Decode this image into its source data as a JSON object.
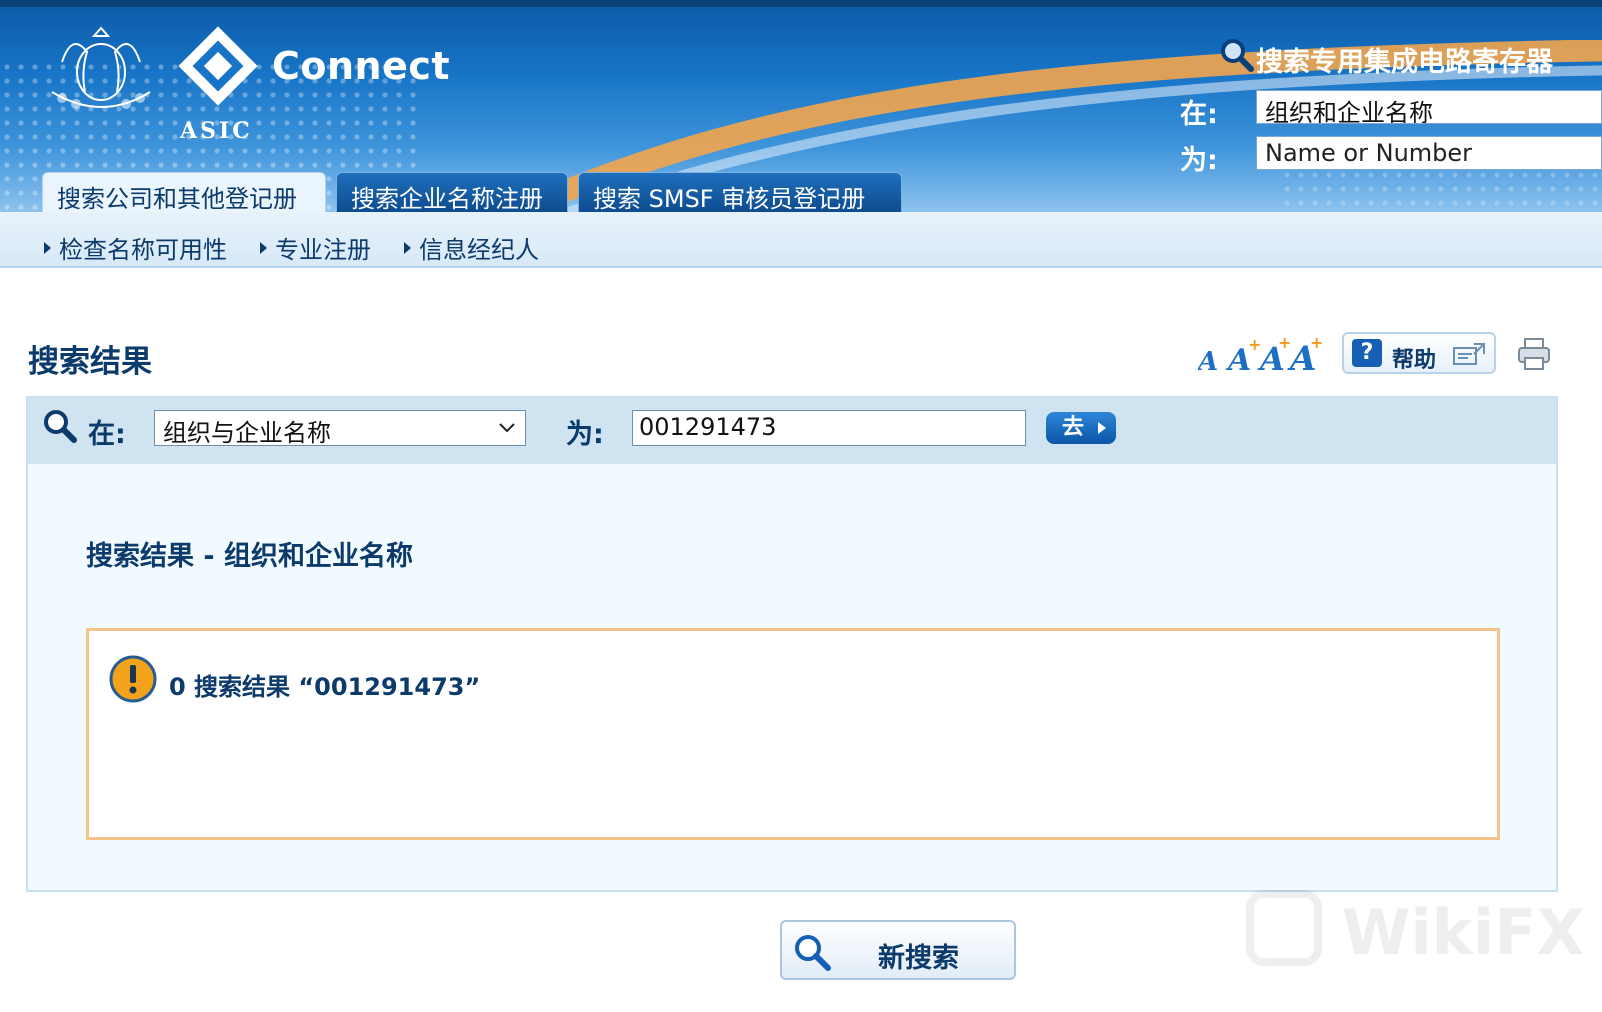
{
  "header": {
    "brand": "Connect",
    "agency": "ASIC",
    "quick_search": {
      "title": "搜索专用集成电路寄存器",
      "in_label": "在:",
      "in_value": "组织和企业名称",
      "for_label": "为:",
      "for_placeholder": "Name or Number"
    },
    "tabs": [
      {
        "label": "搜索公司和其他登记册",
        "active": true
      },
      {
        "label": "搜索企业名称注册",
        "active": false
      },
      {
        "label": "搜索 SMSF 审核员登记册",
        "active": false
      }
    ]
  },
  "subnav": [
    {
      "label": "检查名称可用性"
    },
    {
      "label": "专业注册"
    },
    {
      "label": "信息经纪人"
    }
  ],
  "page": {
    "title": "搜索结果",
    "help_label": "帮助"
  },
  "search_bar": {
    "in_label": "在:",
    "selected_register": "组织与企业名称",
    "for_label": "为:",
    "query": "001291473",
    "go_label": "去"
  },
  "results": {
    "heading": "搜索结果 - 组织和企业名称",
    "message": "0 搜索结果 “001291473”"
  },
  "new_search_label": "新搜索",
  "watermark": "WikiFX",
  "colors": {
    "header_blue": "#1774c6",
    "navy_text": "#0b3a6b",
    "result_border": "#f2c48a",
    "warning_orange": "#f3a21b"
  }
}
